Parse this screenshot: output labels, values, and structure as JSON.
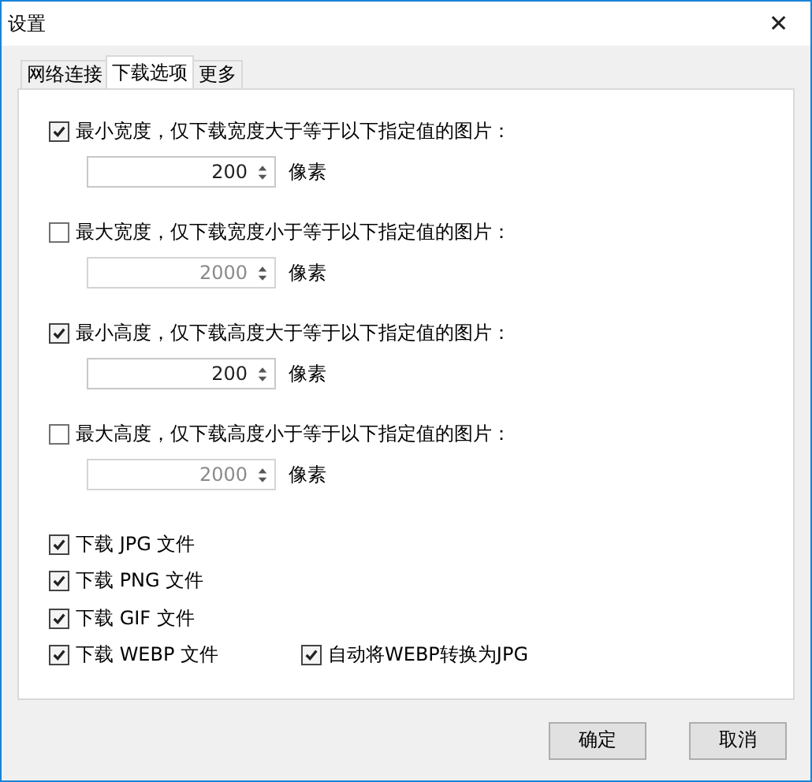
{
  "window": {
    "title": "设置",
    "close": "✕"
  },
  "tabs": [
    {
      "label": "网络连接",
      "selected": false
    },
    {
      "label": "下载选项",
      "selected": true
    },
    {
      "label": "更多",
      "selected": false
    }
  ],
  "size_filters": [
    {
      "label": "最小宽度，仅下载宽度大于等于以下指定值的图片：",
      "checked": true,
      "value": "200",
      "disabled": false,
      "unit": "像素"
    },
    {
      "label": "最大宽度，仅下载宽度小于等于以下指定值的图片：",
      "checked": false,
      "value": "2000",
      "disabled": true,
      "unit": "像素"
    },
    {
      "label": "最小高度，仅下载高度大于等于以下指定值的图片：",
      "checked": true,
      "value": "200",
      "disabled": false,
      "unit": "像素"
    },
    {
      "label": "最大高度，仅下载高度小于等于以下指定值的图片：",
      "checked": false,
      "value": "2000",
      "disabled": true,
      "unit": "像素"
    }
  ],
  "file_rows": [
    [
      {
        "label": "下载 JPG 文件",
        "checked": true
      }
    ],
    [
      {
        "label": "下载 PNG 文件",
        "checked": true
      }
    ],
    [
      {
        "label": "下载 GIF 文件",
        "checked": true
      }
    ],
    [
      {
        "label": "下载 WEBP 文件",
        "checked": true
      },
      {
        "label": "自动将WEBP转换为JPG",
        "checked": true
      }
    ]
  ],
  "buttons": [
    "确定",
    "取消"
  ]
}
